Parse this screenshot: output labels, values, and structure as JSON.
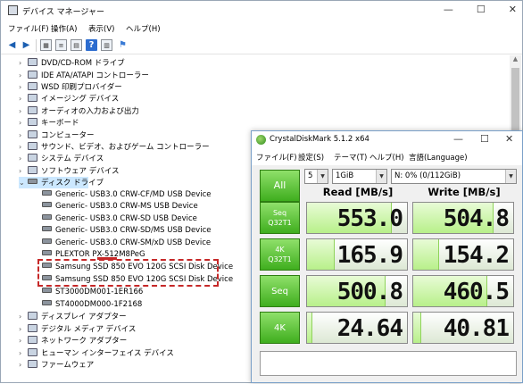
{
  "device_manager": {
    "title": "デバイス マネージャー",
    "window_buttons": [
      "—",
      "☐",
      "✕"
    ],
    "menu": [
      "ファイル(F)",
      "操作(A)",
      "表示(V)",
      "ヘルプ(H)"
    ],
    "tree": [
      {
        "label": "DVD/CD-ROM ドライブ",
        "arrow": "›"
      },
      {
        "label": "IDE ATA/ATAPI コントローラー",
        "arrow": "›"
      },
      {
        "label": "WSD 印刷プロバイダー",
        "arrow": "›"
      },
      {
        "label": "イメージング デバイス",
        "arrow": "›"
      },
      {
        "label": "オーディオの入力および出力",
        "arrow": "›"
      },
      {
        "label": "キーボード",
        "arrow": "›"
      },
      {
        "label": "コンピューター",
        "arrow": "›"
      },
      {
        "label": "サウンド、ビデオ、およびゲーム コントローラー",
        "arrow": "›"
      },
      {
        "label": "システム デバイス",
        "arrow": "›"
      },
      {
        "label": "ソフトウェア デバイス",
        "arrow": "›"
      },
      {
        "label": "ディスク ドライブ",
        "arrow": "⌄"
      },
      {
        "label": "Generic- USB3.0 CRW-CF/MD USB Device"
      },
      {
        "label": "Generic- USB3.0 CRW-MS USB Device"
      },
      {
        "label": "Generic- USB3.0 CRW-SD USB Device"
      },
      {
        "label": "Generic- USB3.0 CRW-SD/MS USB Device"
      },
      {
        "label": "Generic- USB3.0 CRW-SM/xD USB Device"
      },
      {
        "label": "PLEXTOR PX-512M8PeG"
      },
      {
        "label": "Samsung SSD 850 EVO 120G SCSI Disk Device"
      },
      {
        "label": "Samsung SSD 850 EVO 120G SCSI Disk Device"
      },
      {
        "label": "ST3000DM001-1ER166"
      },
      {
        "label": "ST4000DM000-1F2168"
      },
      {
        "label": "ディスプレイ アダプター",
        "arrow": "›"
      },
      {
        "label": "デジタル メディア デバイス",
        "arrow": "›"
      },
      {
        "label": "ネットワーク アダプター",
        "arrow": "›"
      },
      {
        "label": "ヒューマン インターフェイス デバイス",
        "arrow": "›"
      },
      {
        "label": "ファームウェア",
        "arrow": "›"
      }
    ]
  },
  "crystaldiskmark": {
    "title": "CrystalDiskMark 5.1.2 x64",
    "menu": [
      "ファイル(F)",
      "設定(S)",
      "テーマ(T)",
      "ヘルプ(H)",
      "言語(Language)"
    ],
    "window_buttons": [
      "—",
      "☐",
      "✕"
    ],
    "all_button": "All",
    "runs": "5",
    "size": "1GiB",
    "drive": "N: 0% (0/112GiB)",
    "read_header": "Read [MB/s]",
    "write_header": "Write [MB/s]",
    "rows": [
      {
        "line1": "Seq",
        "line2": "Q32T1",
        "read": "553.0",
        "write": "504.8",
        "read_frac": 0.85,
        "write_frac": 0.8
      },
      {
        "line1": "4K",
        "line2": "Q32T1",
        "read": "165.9",
        "write": "154.2",
        "read_frac": 0.28,
        "write_frac": 0.26
      },
      {
        "line1": "Seq",
        "line2": "",
        "read": "500.8",
        "write": "460.5",
        "read_frac": 0.79,
        "write_frac": 0.74
      },
      {
        "line1": "4K",
        "line2": "",
        "read": "24.64",
        "write": "40.81",
        "read_frac": 0.05,
        "write_frac": 0.08
      }
    ]
  }
}
